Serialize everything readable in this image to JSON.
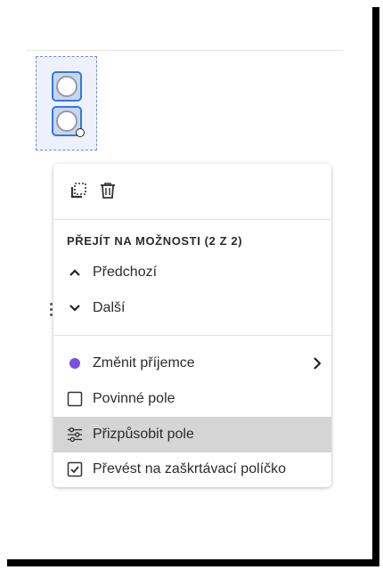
{
  "toolbar": {
    "icons": [
      "duplicate-icon",
      "trash-icon"
    ]
  },
  "menu": {
    "section_title": "PŘEJÍT NA MOŽNOSTI (2 Z 2)",
    "previous_label": "Předchozí",
    "next_label": "Další",
    "change_recipient_label": "Změnit příjemce",
    "recipient_color": "#7b4fe0",
    "required_field_label": "Povinné pole",
    "customize_field_label": "Přizpůsobit pole",
    "convert_checkbox_label": "Převést na zaškrtávací políčko"
  }
}
